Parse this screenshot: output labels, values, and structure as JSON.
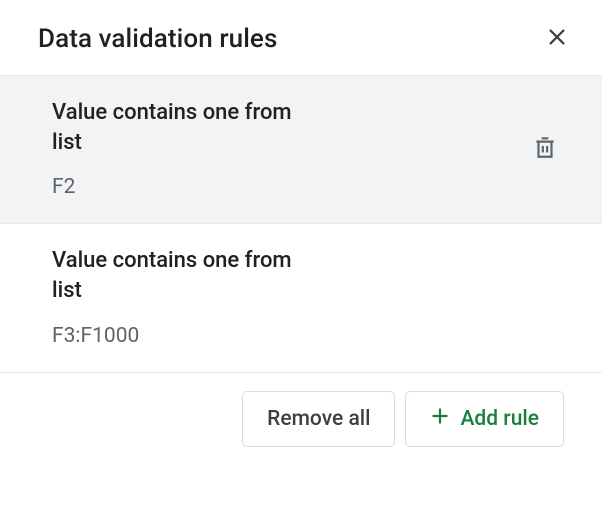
{
  "header": {
    "title": "Data validation rules"
  },
  "rules": [
    {
      "title": "Value contains one from list",
      "range": "F2",
      "selected": true
    },
    {
      "title": "Value contains one from list",
      "range": "F3:F1000",
      "selected": false
    }
  ],
  "footer": {
    "remove_all_label": "Remove all",
    "add_rule_label": "Add rule"
  },
  "icons": {
    "close": "close-icon",
    "trash": "trash-icon",
    "plus": "plus-icon"
  }
}
